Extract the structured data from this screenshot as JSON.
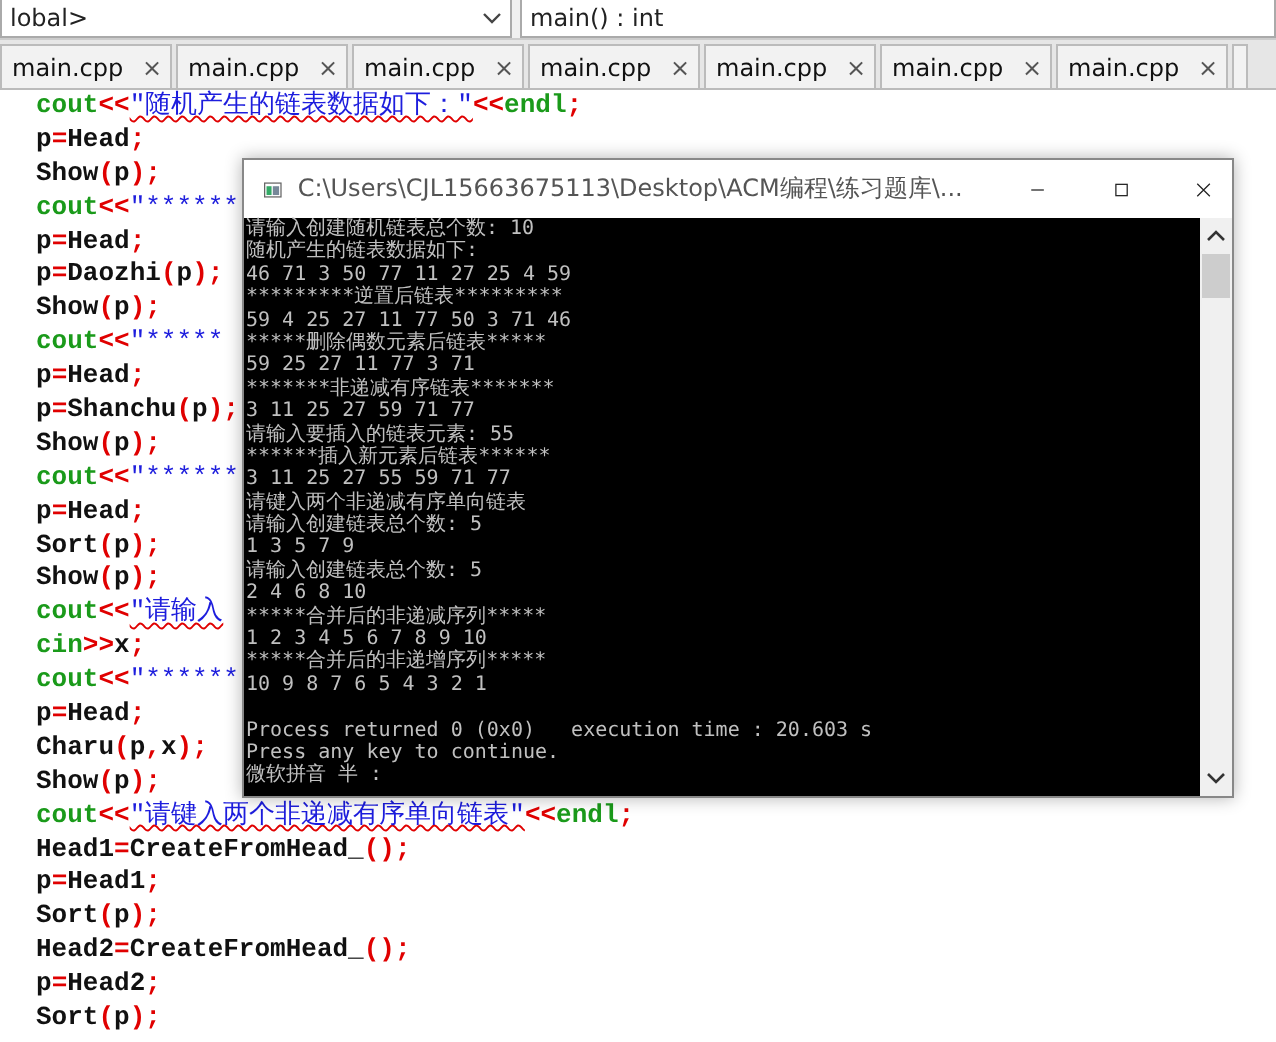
{
  "toolbar": {
    "scope": "lobal>",
    "function": "main() : int"
  },
  "tabs": [
    {
      "label": "main.cpp",
      "selected": false,
      "close": "×"
    },
    {
      "label": "main.cpp",
      "selected": false,
      "close": "×"
    },
    {
      "label": "main.cpp",
      "selected": false,
      "close": "×"
    },
    {
      "label": "main.cpp",
      "selected": false,
      "close": "×"
    },
    {
      "label": "main.cpp",
      "selected": false,
      "close": "×"
    },
    {
      "label": "main.cpp",
      "selected": false,
      "close": "×"
    },
    {
      "label": "main.cpp",
      "selected": false,
      "close": "×"
    }
  ],
  "code": [
    [
      {
        "kind": "kw",
        "text": "cout"
      },
      {
        "kind": "op",
        "text": "<<"
      },
      {
        "kind": "str",
        "text": "\"随机产生的链表数据如下：\"",
        "misspelled": true
      },
      {
        "kind": "op",
        "text": "<<"
      },
      {
        "kind": "kw",
        "text": "endl"
      },
      {
        "kind": "op",
        "text": ";"
      }
    ],
    [
      {
        "kind": "id",
        "text": "p"
      },
      {
        "kind": "op",
        "text": "="
      },
      {
        "kind": "id",
        "text": "Head"
      },
      {
        "kind": "op",
        "text": ";"
      }
    ],
    [
      {
        "kind": "id",
        "text": "Show"
      },
      {
        "kind": "op",
        "text": "("
      },
      {
        "kind": "id",
        "text": "p"
      },
      {
        "kind": "op",
        "text": ");"
      }
    ],
    [
      {
        "kind": "kw",
        "text": "cout"
      },
      {
        "kind": "op",
        "text": "<<"
      },
      {
        "kind": "str",
        "text": "\"******",
        "misspelled": false
      }
    ],
    [
      {
        "kind": "id",
        "text": "p"
      },
      {
        "kind": "op",
        "text": "="
      },
      {
        "kind": "id",
        "text": "Head"
      },
      {
        "kind": "op",
        "text": ";"
      }
    ],
    [
      {
        "kind": "id",
        "text": "p"
      },
      {
        "kind": "op",
        "text": "="
      },
      {
        "kind": "id",
        "text": "Daozhi"
      },
      {
        "kind": "op",
        "text": "("
      },
      {
        "kind": "id",
        "text": "p"
      },
      {
        "kind": "op",
        "text": ");"
      }
    ],
    [
      {
        "kind": "id",
        "text": "Show"
      },
      {
        "kind": "op",
        "text": "("
      },
      {
        "kind": "id",
        "text": "p"
      },
      {
        "kind": "op",
        "text": ");"
      }
    ],
    [
      {
        "kind": "kw",
        "text": "cout"
      },
      {
        "kind": "op",
        "text": "<<"
      },
      {
        "kind": "str",
        "text": "\"*****",
        "misspelled": false
      }
    ],
    [
      {
        "kind": "id",
        "text": "p"
      },
      {
        "kind": "op",
        "text": "="
      },
      {
        "kind": "id",
        "text": "Head"
      },
      {
        "kind": "op",
        "text": ";"
      }
    ],
    [
      {
        "kind": "id",
        "text": "p"
      },
      {
        "kind": "op",
        "text": "="
      },
      {
        "kind": "id",
        "text": "Shanchu"
      },
      {
        "kind": "op",
        "text": "("
      },
      {
        "kind": "id",
        "text": "p"
      },
      {
        "kind": "op",
        "text": ");"
      }
    ],
    [
      {
        "kind": "id",
        "text": "Show"
      },
      {
        "kind": "op",
        "text": "("
      },
      {
        "kind": "id",
        "text": "p"
      },
      {
        "kind": "op",
        "text": ");"
      }
    ],
    [
      {
        "kind": "kw",
        "text": "cout"
      },
      {
        "kind": "op",
        "text": "<<"
      },
      {
        "kind": "str",
        "text": "\"******",
        "misspelled": false
      }
    ],
    [
      {
        "kind": "id",
        "text": "p"
      },
      {
        "kind": "op",
        "text": "="
      },
      {
        "kind": "id",
        "text": "Head"
      },
      {
        "kind": "op",
        "text": ";"
      }
    ],
    [
      {
        "kind": "id",
        "text": "Sort"
      },
      {
        "kind": "op",
        "text": "("
      },
      {
        "kind": "id",
        "text": "p"
      },
      {
        "kind": "op",
        "text": ");"
      }
    ],
    [
      {
        "kind": "id",
        "text": "Show"
      },
      {
        "kind": "op",
        "text": "("
      },
      {
        "kind": "id",
        "text": "p"
      },
      {
        "kind": "op",
        "text": ");"
      }
    ],
    [
      {
        "kind": "kw",
        "text": "cout"
      },
      {
        "kind": "op",
        "text": "<<"
      },
      {
        "kind": "str",
        "text": "\"请输入",
        "misspelled": true
      }
    ],
    [
      {
        "kind": "kw",
        "text": "cin"
      },
      {
        "kind": "op",
        "text": ">>"
      },
      {
        "kind": "id",
        "text": "x"
      },
      {
        "kind": "op",
        "text": ";"
      }
    ],
    [
      {
        "kind": "kw",
        "text": "cout"
      },
      {
        "kind": "op",
        "text": "<<"
      },
      {
        "kind": "str",
        "text": "\"******",
        "misspelled": false
      }
    ],
    [
      {
        "kind": "id",
        "text": "p"
      },
      {
        "kind": "op",
        "text": "="
      },
      {
        "kind": "id",
        "text": "Head"
      },
      {
        "kind": "op",
        "text": ";"
      }
    ],
    [
      {
        "kind": "id",
        "text": "Charu"
      },
      {
        "kind": "op",
        "text": "("
      },
      {
        "kind": "id",
        "text": "p"
      },
      {
        "kind": "op",
        "text": ","
      },
      {
        "kind": "id",
        "text": "x"
      },
      {
        "kind": "op",
        "text": ");"
      }
    ],
    [
      {
        "kind": "id",
        "text": "Show"
      },
      {
        "kind": "op",
        "text": "("
      },
      {
        "kind": "id",
        "text": "p"
      },
      {
        "kind": "op",
        "text": ");"
      }
    ],
    [
      {
        "kind": "kw",
        "text": "cout"
      },
      {
        "kind": "op",
        "text": "<<"
      },
      {
        "kind": "str",
        "text": "\"请键入两个非递减有序单向链表\"",
        "misspelled": true
      },
      {
        "kind": "op",
        "text": "<<"
      },
      {
        "kind": "kw",
        "text": "endl"
      },
      {
        "kind": "op",
        "text": ";"
      }
    ],
    [
      {
        "kind": "id",
        "text": "Head1"
      },
      {
        "kind": "op",
        "text": "="
      },
      {
        "kind": "id",
        "text": "CreateFromHead_"
      },
      {
        "kind": "op",
        "text": "();"
      }
    ],
    [
      {
        "kind": "id",
        "text": "p"
      },
      {
        "kind": "op",
        "text": "="
      },
      {
        "kind": "id",
        "text": "Head1"
      },
      {
        "kind": "op",
        "text": ";"
      }
    ],
    [
      {
        "kind": "id",
        "text": "Sort"
      },
      {
        "kind": "op",
        "text": "("
      },
      {
        "kind": "id",
        "text": "p"
      },
      {
        "kind": "op",
        "text": ");"
      }
    ],
    [
      {
        "kind": "id",
        "text": "Head2"
      },
      {
        "kind": "op",
        "text": "="
      },
      {
        "kind": "id",
        "text": "CreateFromHead_"
      },
      {
        "kind": "op",
        "text": "();"
      }
    ],
    [
      {
        "kind": "id",
        "text": "p"
      },
      {
        "kind": "op",
        "text": "="
      },
      {
        "kind": "id",
        "text": "Head2"
      },
      {
        "kind": "op",
        "text": ";"
      }
    ],
    [
      {
        "kind": "id",
        "text": "Sort"
      },
      {
        "kind": "op",
        "text": "("
      },
      {
        "kind": "id",
        "text": "p"
      },
      {
        "kind": "op",
        "text": ");"
      }
    ]
  ],
  "console": {
    "title": "C:\\Users\\CJL15663675113\\Desktop\\ACM编程\\练习题库\\...",
    "lines": [
      "请输入创建随机链表总个数: 10",
      "随机产生的链表数据如下:",
      "46 71 3 50 77 11 27 25 4 59",
      "*********逆置后链表*********",
      "59 4 25 27 11 77 50 3 71 46",
      "*****删除偶数元素后链表*****",
      "59 25 27 11 77 3 71",
      "*******非递减有序链表*******",
      "3 11 25 27 59 71 77",
      "请输入要插入的链表元素: 55",
      "******插入新元素后链表******",
      "3 11 25 27 55 59 71 77",
      "请键入两个非递减有序单向链表",
      "请输入创建链表总个数: 5",
      "1 3 5 7 9",
      "请输入创建链表总个数: 5",
      "2 4 6 8 10",
      "*****合并后的非递减序列*****",
      "1 2 3 4 5 6 7 8 9 10",
      "*****合并后的非递增序列*****",
      "10 9 8 7 6 5 4 3 2 1"
    ],
    "footer_lines": [
      "Process returned 0 (0x0)   execution time : 20.603 s",
      "Press any key to continue.",
      "微软拼音 半 :"
    ]
  }
}
